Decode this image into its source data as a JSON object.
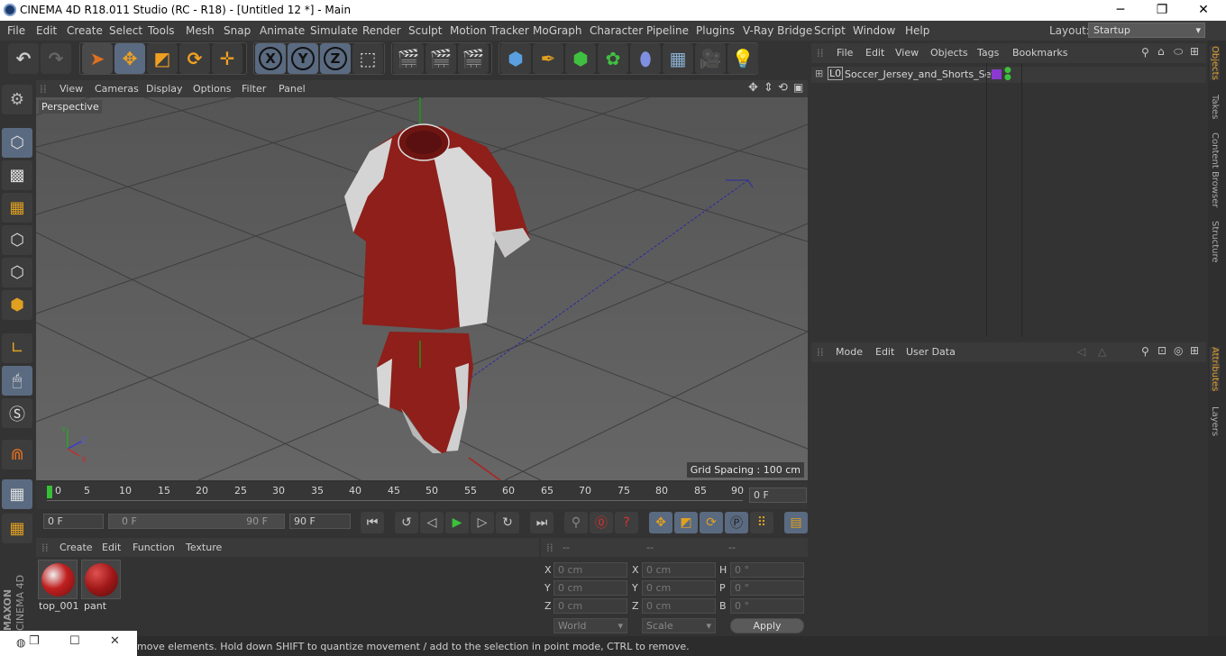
{
  "window": {
    "title": "CINEMA 4D R18.011 Studio (RC - R18) - [Untitled 12 *] - Main",
    "minimize": "─",
    "restore": "❐",
    "close": "✕"
  },
  "menubar": {
    "items": [
      "File",
      "Edit",
      "Create",
      "Select",
      "Tools",
      "Mesh",
      "Snap",
      "Animate",
      "Simulate",
      "Render",
      "Sculpt",
      "Motion Tracker",
      "MoGraph",
      "Character",
      "Pipeline",
      "Plugins",
      "V-Ray Bridge",
      "Script",
      "Window",
      "Help"
    ],
    "layout_label": "Layout:",
    "layout_value": "Startup"
  },
  "toolbar": {
    "undo_icon": "undo-icon",
    "redo_icon": "redo-icon",
    "axis_x": "X",
    "axis_y": "Y",
    "axis_z": "Z"
  },
  "viewport": {
    "menu": [
      "View",
      "Cameras",
      "Display",
      "Options",
      "Filter",
      "Panel"
    ],
    "camera_label": "Perspective",
    "grid_spacing": "Grid Spacing : 100 cm",
    "axis_x": "X",
    "axis_y": "Y",
    "axis_z": "Z"
  },
  "timeline": {
    "ticks": [
      "0",
      "5",
      "10",
      "15",
      "20",
      "25",
      "30",
      "35",
      "40",
      "45",
      "50",
      "55",
      "60",
      "65",
      "70",
      "75",
      "80",
      "85",
      "90"
    ],
    "current_frame": "0 F"
  },
  "transport": {
    "start_field": "0 F",
    "range_start": "0 F",
    "range_end": "90 F",
    "end_field": "90 F"
  },
  "materials": {
    "menu": [
      "Create",
      "Edit",
      "Function",
      "Texture"
    ],
    "items": [
      {
        "name": "top_001"
      },
      {
        "name": "pant"
      }
    ]
  },
  "coordinates": {
    "headers": [
      "--",
      "--",
      "--"
    ],
    "rows": [
      {
        "a_label": "X",
        "a_val": "0 cm",
        "b_label": "X",
        "b_val": "0 cm",
        "c_label": "H",
        "c_val": "0 °"
      },
      {
        "a_label": "Y",
        "a_val": "0 cm",
        "b_label": "Y",
        "b_val": "0 cm",
        "c_label": "P",
        "c_val": "0 °"
      },
      {
        "a_label": "Z",
        "a_val": "0 cm",
        "b_label": "Z",
        "b_val": "0 cm",
        "c_label": "B",
        "c_val": "0 °"
      }
    ],
    "mode_select": "World",
    "size_select": "Scale",
    "apply_label": "Apply"
  },
  "objects_panel": {
    "menu": [
      "File",
      "Edit",
      "View",
      "Objects",
      "Tags",
      "Bookmarks"
    ],
    "objects": [
      {
        "name": "Soccer_Jersey_and_Shorts_Set",
        "layer_icon": "L0"
      }
    ]
  },
  "attributes_panel": {
    "menu": [
      "Mode",
      "Edit",
      "User Data"
    ]
  },
  "side_tabs": [
    "Objects",
    "Takes",
    "Content Browser",
    "Structure"
  ],
  "side_tabs_lower": [
    "Attributes",
    "Layers"
  ],
  "status_text": "move elements. Hold down SHIFT to quantize movement / add to the selection in point mode, CTRL to remove.",
  "brand": "MAXON CINEMA 4D"
}
